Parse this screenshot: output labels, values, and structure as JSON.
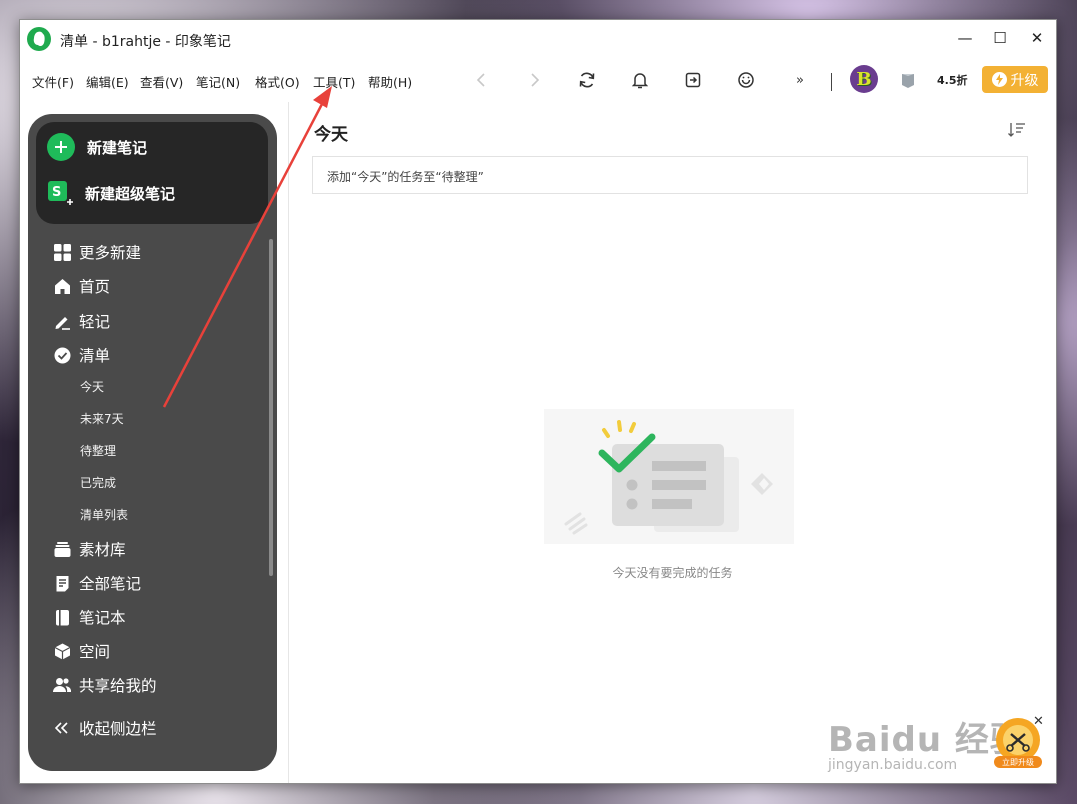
{
  "window": {
    "title": "清单 - b1rahtje - 印象笔记",
    "controls": {
      "minimize": "—",
      "maximize": "☐",
      "close": "✕"
    }
  },
  "menu": [
    "文件(F)",
    "编辑(E)",
    "查看(V)",
    "笔记(N)",
    "格式(O)",
    "工具(T)",
    "帮助(H)"
  ],
  "toolbar": {
    "icons": [
      "back-arrow-icon",
      "forward-arrow-icon",
      "sync-icon",
      "bell-icon",
      "share-icon",
      "emoji-icon",
      "more-icon"
    ],
    "discount": "4.5折",
    "upgrade_label": "升级",
    "avatar_letter": "B"
  },
  "sidebar": {
    "new_note": "新建笔记",
    "new_super_note": "新建超级笔记",
    "items": {
      "more_new": "更多新建",
      "home": "首页",
      "light_note": "轻记",
      "checklist": "清单",
      "materials": "素材库",
      "all_notes": "全部笔记",
      "notebooks": "笔记本",
      "spaces": "空间",
      "shared": "共享给我的",
      "collapse": "收起侧边栏"
    },
    "checklist_sub": [
      "今天",
      "未来7天",
      "待整理",
      "已完成",
      "清单列表"
    ]
  },
  "main": {
    "title": "今天",
    "add_task_text": "添加“今天”的任务至“待整理”",
    "empty_text": "今天没有要完成的任务"
  },
  "overlay": {
    "watermark": "Baidu 经验",
    "watermark_url": "jingyan.baidu.com",
    "promo_label": "立即升级",
    "promo_close": "✕"
  },
  "colors": {
    "brand_green": "#1fbb5a",
    "upgrade": "#f3b134",
    "sidebar_bg": "#4a4a4a",
    "annotation_arrow": "#e8413a"
  }
}
